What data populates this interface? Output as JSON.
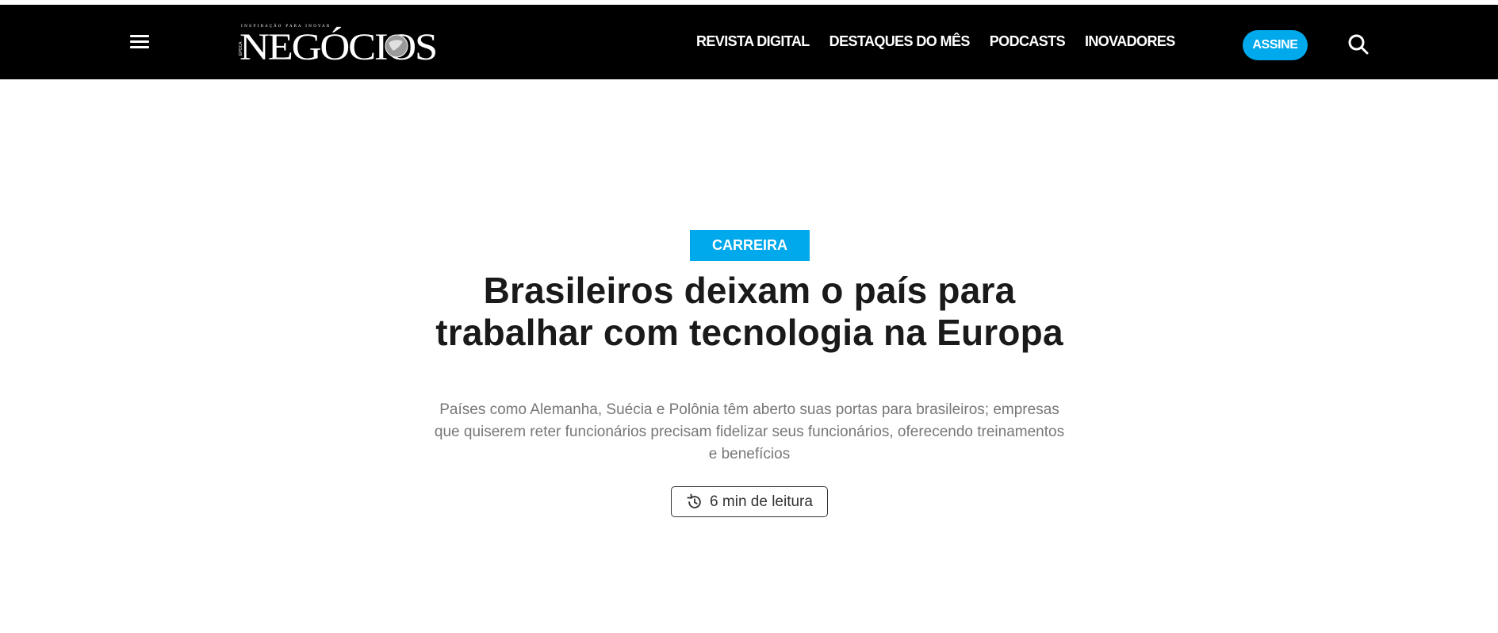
{
  "brand": {
    "name": "NEGÓCIOS",
    "prefix": "ÉPOCA",
    "tagline": "INSPIRAÇÃO PARA INOVAR"
  },
  "nav": {
    "menu_icon": "hamburger-icon",
    "links": [
      "REVISTA DIGITAL",
      "DESTAQUES DO MÊS",
      "PODCASTS",
      "INOVADORES"
    ],
    "subscribe_label": "ASSINE",
    "search_icon": "search-icon"
  },
  "article": {
    "category": "CARREIRA",
    "headline": "Brasileiros deixam o país para trabalhar com tecnologia na Europa",
    "subtitle": "Países como Alemanha, Suécia e Polônia têm aberto suas portas para brasileiros; empresas que quiserem reter funcionários precisam fidelizar seus funcionários, oferecendo treinamentos e benefícios",
    "read_time_label": "6 min de leitura",
    "read_time_icon": "history-clock-icon"
  },
  "colors": {
    "navbar_bg": "#000000",
    "accent": "#00a8ec",
    "headline": "#1a1a1a",
    "subtitle": "#777777"
  }
}
